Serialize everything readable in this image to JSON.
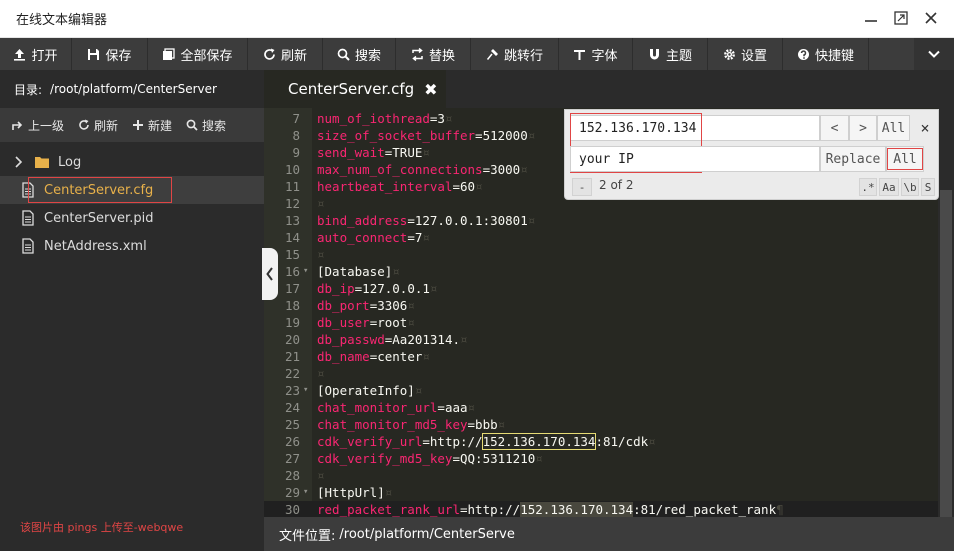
{
  "window": {
    "title": "在线文本编辑器"
  },
  "toolbar": {
    "items": [
      {
        "icon": "upload-icon",
        "label": "打开"
      },
      {
        "icon": "save-icon",
        "label": "保存"
      },
      {
        "icon": "save-all-icon",
        "label": "全部保存"
      },
      {
        "icon": "refresh-icon",
        "label": "刷新"
      },
      {
        "icon": "search-icon",
        "label": "搜索"
      },
      {
        "icon": "replace-icon",
        "label": "替换"
      },
      {
        "icon": "goto-icon",
        "label": "跳转行"
      },
      {
        "icon": "font-icon",
        "label": "字体"
      },
      {
        "icon": "theme-icon",
        "label": "主题"
      },
      {
        "icon": "gear-icon",
        "label": "设置"
      },
      {
        "icon": "shortcut-icon",
        "label": "快捷键"
      }
    ]
  },
  "sidebar": {
    "dir_label": "目录:",
    "dir_path": "/root/platform/CenterServer",
    "tools": [
      {
        "icon": "up-arrow-icon",
        "label": "上一级"
      },
      {
        "icon": "refresh-icon",
        "label": "刷新"
      },
      {
        "icon": "plus-icon",
        "label": "新建"
      },
      {
        "icon": "search-icon",
        "label": "搜索"
      }
    ],
    "tree": [
      {
        "type": "folder",
        "label": "Log"
      },
      {
        "type": "file",
        "label": "CenterServer.cfg",
        "active": true
      },
      {
        "type": "file",
        "label": "CenterServer.pid"
      },
      {
        "type": "file",
        "label": "NetAddress.xml"
      }
    ],
    "watermark": "该图片由 pings 上传至-webqwe"
  },
  "editor": {
    "tab_label": "CenterServer.cfg",
    "tab_close": "✖",
    "lines": [
      {
        "n": "7",
        "key": "num_of_iothread",
        "val": "3"
      },
      {
        "n": "8",
        "key": "size_of_socket_buffer",
        "val": "512000"
      },
      {
        "n": "9",
        "key": "send_wait",
        "val": "TRUE"
      },
      {
        "n": "10",
        "key": "max_num_of_connections",
        "val": "3000"
      },
      {
        "n": "11",
        "key": "heartbeat_interval",
        "val": "60"
      },
      {
        "n": "12"
      },
      {
        "n": "13",
        "key": "bind_address",
        "val": "127.0.0.1:30801"
      },
      {
        "n": "14",
        "key": "auto_connect",
        "val": "7"
      },
      {
        "n": "15"
      },
      {
        "n": "16",
        "section": "[Database]",
        "fold": true
      },
      {
        "n": "17",
        "key": "db_ip",
        "val": "127.0.0.1"
      },
      {
        "n": "18",
        "key": "db_port",
        "val": "3306"
      },
      {
        "n": "19",
        "key": "db_user",
        "val": "root"
      },
      {
        "n": "20",
        "key": "db_passwd",
        "val": "Aa201314."
      },
      {
        "n": "21",
        "key": "db_name",
        "val": "center"
      },
      {
        "n": "22"
      },
      {
        "n": "23",
        "section": "[OperateInfo]",
        "fold": true
      },
      {
        "n": "24",
        "key": "chat_monitor_url",
        "val": "aaa"
      },
      {
        "n": "25",
        "key": "chat_monitor_md5_key",
        "val": "bbb"
      },
      {
        "n": "26",
        "key": "cdk_verify_url",
        "val_pre": "http://",
        "val_match": "152.136.170.134",
        "val_post": ":81/cdk",
        "match": "found"
      },
      {
        "n": "27",
        "key": "cdk_verify_md5_key",
        "val": "QQ:5311210"
      },
      {
        "n": "28"
      },
      {
        "n": "29",
        "section": "[HttpUrl]",
        "fold": true
      },
      {
        "n": "30",
        "key": "red_packet_rank_url",
        "val_pre": "http://",
        "val_match": "152.136.170.134",
        "val_post": ":81/red_packet_rank",
        "match": "selected",
        "current": true,
        "eol": "¶"
      }
    ],
    "eol_marker": "¤"
  },
  "search": {
    "find_value": "152.136.170.134",
    "replace_value": "your IP",
    "prev_label": "<",
    "next_label": ">",
    "find_all_label": "All",
    "close_label": "×",
    "replace_label": "Replace",
    "replace_all_label": "All",
    "toggle_label": "-",
    "match_count": "2 of 2",
    "options": [
      ".*",
      "Aa",
      "\\b",
      "S"
    ]
  },
  "status": {
    "label": "文件位置:",
    "path": "/root/platform/CenterServe"
  }
}
